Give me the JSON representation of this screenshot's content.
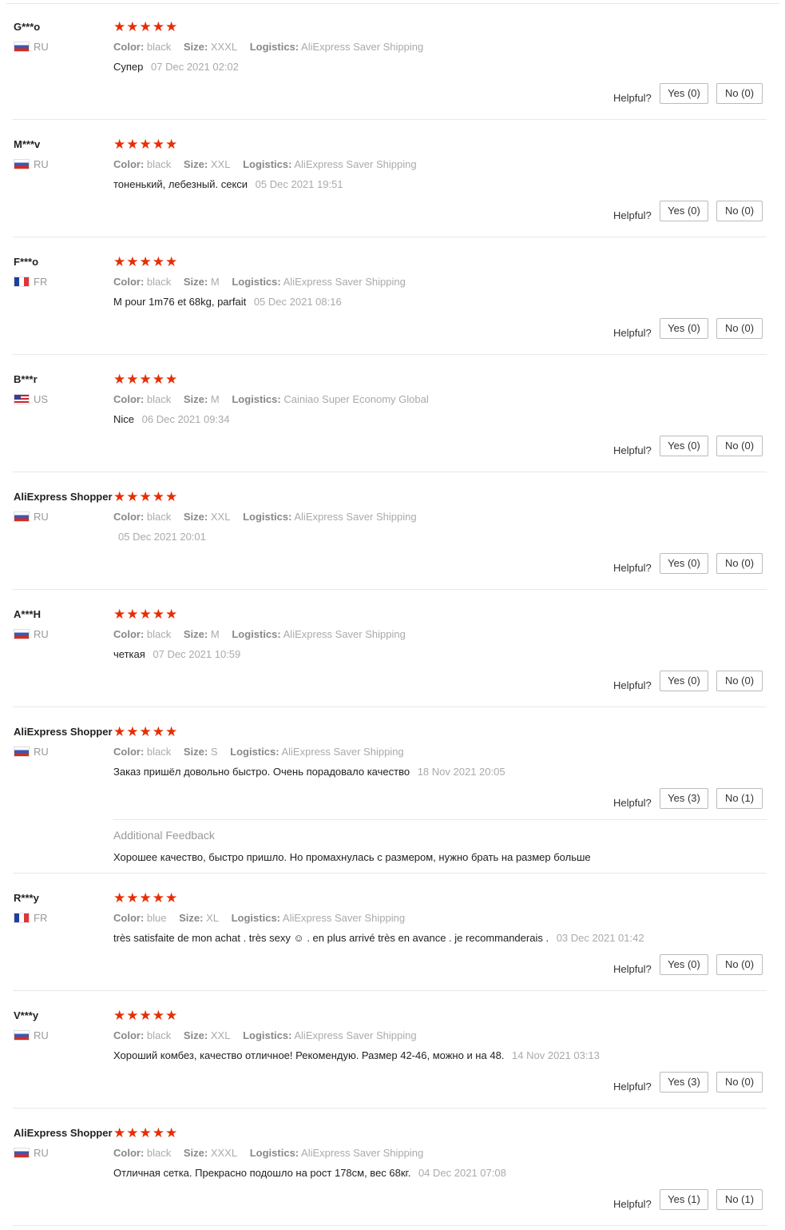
{
  "helpful_label": "Helpful?",
  "labels": {
    "color": "Color:",
    "size": "Size:",
    "logistics": "Logistics:"
  },
  "stars": "★★★★★",
  "reviews": [
    {
      "user": "G***o",
      "country": "RU",
      "flag": "ru",
      "color": "black",
      "size": "XXXL",
      "logistics": "AliExpress Saver Shipping",
      "text": "Супер",
      "date": "07 Dec 2021 02:02",
      "yes": "Yes (0)",
      "no": "No (0)"
    },
    {
      "user": "M***v",
      "country": "RU",
      "flag": "ru",
      "color": "black",
      "size": "XXL",
      "logistics": "AliExpress Saver Shipping",
      "text": "тоненький, лебезный. секси",
      "date": "05 Dec 2021 19:51",
      "yes": "Yes (0)",
      "no": "No (0)"
    },
    {
      "user": "F***o",
      "country": "FR",
      "flag": "fr",
      "color": "black",
      "size": "M",
      "logistics": "AliExpress Saver Shipping",
      "text": "M pour 1m76 et 68kg, parfait",
      "date": "05 Dec 2021 08:16",
      "yes": "Yes (0)",
      "no": "No (0)"
    },
    {
      "user": "B***r",
      "country": "US",
      "flag": "us",
      "color": "black",
      "size": "M",
      "logistics": "Cainiao Super Economy Global",
      "text": "Nice",
      "date": "06 Dec 2021 09:34",
      "yes": "Yes (0)",
      "no": "No (0)"
    },
    {
      "user": "AliExpress Shopper",
      "country": "RU",
      "flag": "ru",
      "color": "black",
      "size": "XXL",
      "logistics": "AliExpress Saver Shipping",
      "text": "",
      "date": "05 Dec 2021 20:01",
      "yes": "Yes (0)",
      "no": "No (0)"
    },
    {
      "user": "A***H",
      "country": "RU",
      "flag": "ru",
      "color": "black",
      "size": "M",
      "logistics": "AliExpress Saver Shipping",
      "text": "четкая",
      "date": "07 Dec 2021 10:59",
      "yes": "Yes (0)",
      "no": "No (0)"
    },
    {
      "user": "AliExpress Shopper",
      "country": "RU",
      "flag": "ru",
      "color": "black",
      "size": "S",
      "logistics": "AliExpress Saver Shipping",
      "text": "Заказ пришёл довольно быстро. Очень порадовало качество",
      "date": "18 Nov 2021 20:05",
      "yes": "Yes (3)",
      "no": "No (1)"
    },
    {
      "user": "R***y",
      "country": "FR",
      "flag": "fr",
      "color": "blue",
      "size": "XL",
      "logistics": "AliExpress Saver Shipping",
      "text": "très satisfaite de mon achat . très sexy ☺ . en plus arrivé très en avance . je recommanderais .",
      "date": "03 Dec 2021 01:42",
      "yes": "Yes (0)",
      "no": "No (0)"
    },
    {
      "user": "V***y",
      "country": "RU",
      "flag": "ru",
      "color": "black",
      "size": "XXL",
      "logistics": "AliExpress Saver Shipping",
      "text": "Хороший комбез, качество отличное! Рекомендую. Размер 42-46, можно и на 48.",
      "date": "14 Nov 2021 03:13",
      "yes": "Yes (3)",
      "no": "No (0)"
    },
    {
      "user": "AliExpress Shopper",
      "country": "RU",
      "flag": "ru",
      "color": "black",
      "size": "XXXL",
      "logistics": "AliExpress Saver Shipping",
      "text": "Отличная сетка. Прекрасно подошло на рост 178см, вес 68кг.",
      "date": "04 Dec 2021 07:08",
      "yes": "Yes (1)",
      "no": "No (1)"
    }
  ],
  "additional_feedback": {
    "title": "Additional Feedback",
    "text": "Хорошее качество, быстро пришло. Но промахнулась с размером, нужно брать на размер больше"
  },
  "colors": {
    "star": "#e62e04",
    "muted": "#999999",
    "border": "#e8e8e8"
  }
}
